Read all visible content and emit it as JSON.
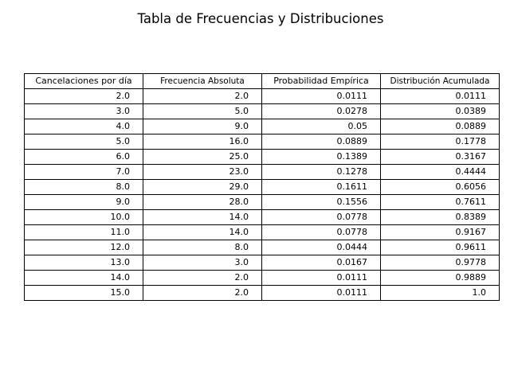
{
  "chart_data": {
    "type": "table",
    "title": "Tabla de Frecuencias y Distribuciones",
    "columns": [
      "Cancelaciones por día",
      "Frecuencia Absoluta",
      "Probabilidad Empírica",
      "Distribución Acumulada"
    ],
    "rows": [
      [
        "2.0",
        "2.0",
        "0.0111",
        "0.0111"
      ],
      [
        "3.0",
        "5.0",
        "0.0278",
        "0.0389"
      ],
      [
        "4.0",
        "9.0",
        "0.05",
        "0.0889"
      ],
      [
        "5.0",
        "16.0",
        "0.0889",
        "0.1778"
      ],
      [
        "6.0",
        "25.0",
        "0.1389",
        "0.3167"
      ],
      [
        "7.0",
        "23.0",
        "0.1278",
        "0.4444"
      ],
      [
        "8.0",
        "29.0",
        "0.1611",
        "0.6056"
      ],
      [
        "9.0",
        "28.0",
        "0.1556",
        "0.7611"
      ],
      [
        "10.0",
        "14.0",
        "0.0778",
        "0.8389"
      ],
      [
        "11.0",
        "14.0",
        "0.0778",
        "0.9167"
      ],
      [
        "12.0",
        "8.0",
        "0.0444",
        "0.9611"
      ],
      [
        "13.0",
        "3.0",
        "0.0167",
        "0.9778"
      ],
      [
        "14.0",
        "2.0",
        "0.0111",
        "0.9889"
      ],
      [
        "15.0",
        "2.0",
        "0.0111",
        "1.0"
      ]
    ]
  }
}
